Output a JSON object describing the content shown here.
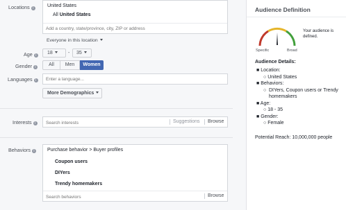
{
  "locations": {
    "label": "Locations",
    "country": "United States",
    "include_prefix": "All",
    "include_value": "United States",
    "placeholder": "Add a country, state/province, city, ZIP or address",
    "scope": "Everyone in this location"
  },
  "age": {
    "label": "Age",
    "min": "18",
    "max": "35",
    "separator": "-"
  },
  "gender": {
    "label": "Gender",
    "options": [
      "All",
      "Men",
      "Women"
    ],
    "selected": "Women"
  },
  "languages": {
    "label": "Languages",
    "placeholder": "Enter a language..."
  },
  "more_demographics": "More Demographics",
  "interests": {
    "label": "Interests",
    "placeholder": "Search interests",
    "suggestions": "Suggestions",
    "browse": "Browse"
  },
  "behaviors": {
    "label": "Behaviors",
    "path": "Purchase behavior > Buyer profiles",
    "items": [
      "Coupon users",
      "DIYers",
      "Trendy homemakers"
    ],
    "placeholder": "Search behaviors",
    "browse": "Browse"
  },
  "audience": {
    "title": "Audience Definition",
    "message": "Your audience is defined.",
    "gauge_left": "Specific",
    "gauge_right": "Broad",
    "details_title": "Audience Details:",
    "details": [
      {
        "key": "Location:",
        "values": [
          "United States"
        ]
      },
      {
        "key": "Behaviors:",
        "values": [
          "DIYers, Coupon users or Trendy homemakers"
        ]
      },
      {
        "key": "Age:",
        "values": [
          "18 - 35"
        ]
      },
      {
        "key": "Gender:",
        "values": [
          "Female"
        ]
      }
    ],
    "reach_label": "Potential Reach:",
    "reach_value": "10,000,000 people"
  },
  "colors": {
    "accent": "#4267b2",
    "gauge_red": "#c0392b",
    "gauge_yellow": "#e5b52b",
    "gauge_green": "#42a03c"
  }
}
